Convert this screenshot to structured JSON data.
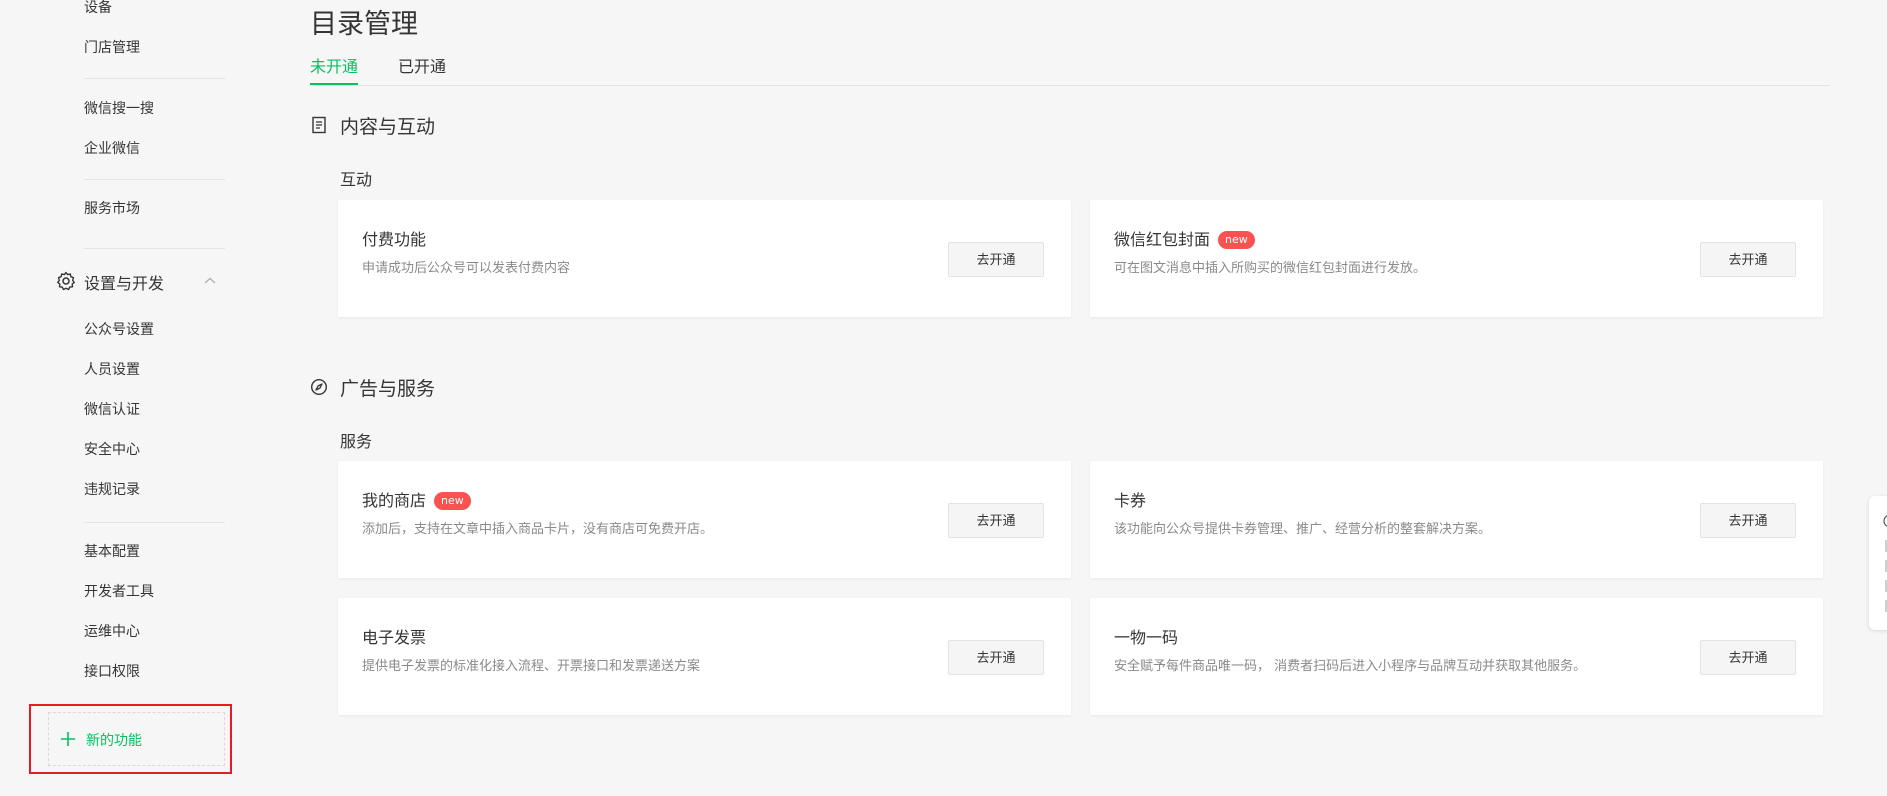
{
  "sidebar": {
    "top_items": [
      {
        "label": "设备"
      },
      {
        "label": "门店管理"
      },
      {
        "label": "微信搜一搜"
      },
      {
        "label": "企业微信"
      },
      {
        "label": "服务市场"
      }
    ],
    "section": {
      "label": "设置与开发",
      "icon": "gear-icon",
      "expanded": true
    },
    "section_items": [
      {
        "label": "公众号设置"
      },
      {
        "label": "人员设置"
      },
      {
        "label": "微信认证"
      },
      {
        "label": "安全中心"
      },
      {
        "label": "违规记录"
      },
      {
        "label": "基本配置"
      },
      {
        "label": "开发者工具"
      },
      {
        "label": "运维中心"
      },
      {
        "label": "接口权限"
      }
    ],
    "new_function": {
      "label": "新的功能",
      "icon": "plus-icon"
    }
  },
  "main": {
    "title": "目录管理",
    "tabs": [
      {
        "label": "未开通",
        "active": true
      },
      {
        "label": "已开通",
        "active": false
      }
    ],
    "groups": [
      {
        "title": "内容与互动",
        "icon": "document-icon",
        "subgroup": "互动",
        "cards": [
          {
            "title": "付费功能",
            "badge": "",
            "desc": "申请成功后公众号可以发表付费内容",
            "button": "去开通"
          },
          {
            "title": "微信红包封面",
            "badge": "new",
            "desc": "可在图文消息中插入所购买的微信红包封面进行发放。",
            "button": "去开通"
          }
        ]
      },
      {
        "title": "广告与服务",
        "icon": "compass-icon",
        "subgroup": "服务",
        "cards": [
          {
            "title": "我的商店",
            "badge": "new",
            "desc": "添加后，支持在文章中插入商品卡片，没有商店可免费开店。",
            "button": "去开通"
          },
          {
            "title": "卡券",
            "badge": "",
            "desc": "该功能向公众号提供卡券管理、推广、经营分析的整套解决方案。",
            "button": "去开通"
          },
          {
            "title": "电子发票",
            "badge": "",
            "desc": "提供电子发票的标准化接入流程、开票接口和发票递送方案",
            "button": "去开通"
          },
          {
            "title": "一物一码",
            "badge": "",
            "desc": "安全赋予每件商品唯一码， 消费者扫码后进入小程序与品牌互动并获取其他服务。",
            "button": "去开通"
          }
        ]
      }
    ]
  },
  "colors": {
    "accent": "#07c160",
    "badge": "#fa5151",
    "highlight_outline": "#e51d23",
    "background": "#f6f6f6"
  }
}
